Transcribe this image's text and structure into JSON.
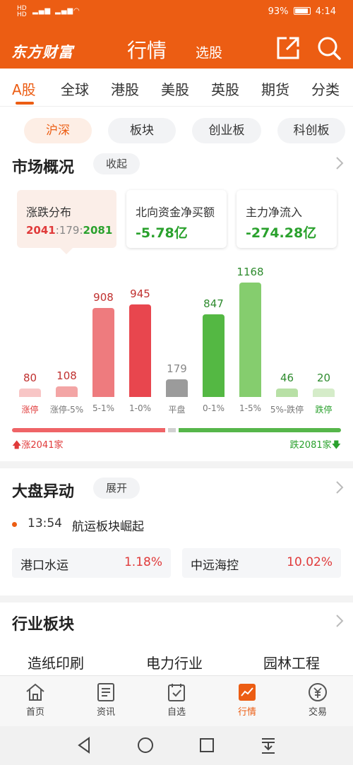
{
  "status": {
    "left": "HD 46 46",
    "battery": "93%",
    "time": "4:14"
  },
  "header": {
    "logo": "东方财富",
    "title": "行情",
    "subtitle": "选股",
    "icons": [
      "share-icon",
      "search-icon"
    ]
  },
  "tabs": [
    "A股",
    "全球",
    "港股",
    "美股",
    "英股",
    "期货",
    "分类"
  ],
  "subtabs": [
    "沪深",
    "板块",
    "创业板",
    "科创板"
  ],
  "market": {
    "title": "市场概况",
    "collapse_label": "收起",
    "stats": [
      {
        "label": "涨跌分布",
        "value_up": "2041",
        "sep1": ":",
        "value_flat": "179",
        "sep2": ":",
        "value_down": "2081"
      },
      {
        "label": "北向资金净买额",
        "value": "-5.78亿"
      },
      {
        "label": "主力净流入",
        "value": "-274.28亿"
      }
    ],
    "distribution": {
      "categories": [
        "涨停",
        "涨停-5%",
        "5-1%",
        "1-0%",
        "平盘",
        "0-1%",
        "1-5%",
        "5%-跌停",
        "跌停"
      ],
      "values": [
        80,
        108,
        908,
        945,
        179,
        847,
        1168,
        46,
        20
      ],
      "colors": [
        "#f8c6c6",
        "#f3a5a5",
        "#ee7b7e",
        "#e8464e",
        "#9b9b9b",
        "#54b843",
        "#85cd6e",
        "#b8e0a6",
        "#d5ecc9"
      ],
      "value_colors": [
        "#c0302f",
        "#c0302f",
        "#c0302f",
        "#c0302f",
        "#888888",
        "#2e8b2e",
        "#2e8b2e",
        "#2e8b2e",
        "#2e8b2e"
      ]
    },
    "footer_up": "涨2041家",
    "footer_down": "跌2081家",
    "up_count": 2041,
    "down_count": 2081
  },
  "movement": {
    "title": "大盘异动",
    "expand_label": "展开",
    "news_time": "13:54",
    "news_text": "航运板块崛起",
    "stocks": [
      {
        "name": "港口水运",
        "change": "1.18%"
      },
      {
        "name": "中远海控",
        "change": "10.02%"
      }
    ]
  },
  "industry": {
    "title": "行业板块",
    "items": [
      "造纸印刷",
      "电力行业",
      "园林工程"
    ]
  },
  "bottom_nav": [
    {
      "label": "首页",
      "icon": "home-icon"
    },
    {
      "label": "资讯",
      "icon": "news-icon"
    },
    {
      "label": "自选",
      "icon": "watchlist-icon"
    },
    {
      "label": "行情",
      "icon": "market-icon"
    },
    {
      "label": "交易",
      "icon": "trade-icon"
    }
  ],
  "colors": {
    "brand": "#ec5d13",
    "up": "#e03a3a",
    "down": "#2aa12d"
  }
}
